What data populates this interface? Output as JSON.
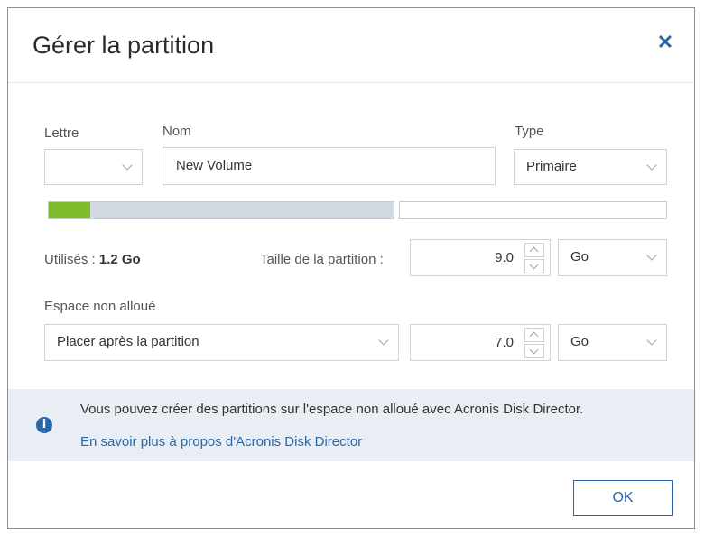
{
  "dialog": {
    "title": "Gérer la partition",
    "close_icon": "close-icon"
  },
  "fields": {
    "letter_label": "Lettre",
    "letter_value": "",
    "name_label": "Nom",
    "name_value": "New Volume",
    "type_label": "Type",
    "type_value": "Primaire"
  },
  "usage": {
    "used_fraction": 0.12,
    "used_label": "Utilisés :",
    "used_value": "1.2 Go"
  },
  "partition_size": {
    "label": "Taille de la partition :",
    "value": "9.0",
    "unit": "Go"
  },
  "unallocated": {
    "label": "Espace non alloué",
    "placement": "Placer après la partition",
    "value": "7.0",
    "unit": "Go"
  },
  "info": {
    "icon": "info-icon",
    "text": "Vous pouvez créer des partitions sur l'espace non alloué avec Acronis Disk Director.",
    "link": "En savoir plus à propos d'Acronis Disk Director"
  },
  "footer": {
    "ok_label": "OK"
  },
  "colors": {
    "accent": "#2a66a8",
    "used_bar": "#7dbb2a",
    "info_bg": "#e8eef4"
  }
}
